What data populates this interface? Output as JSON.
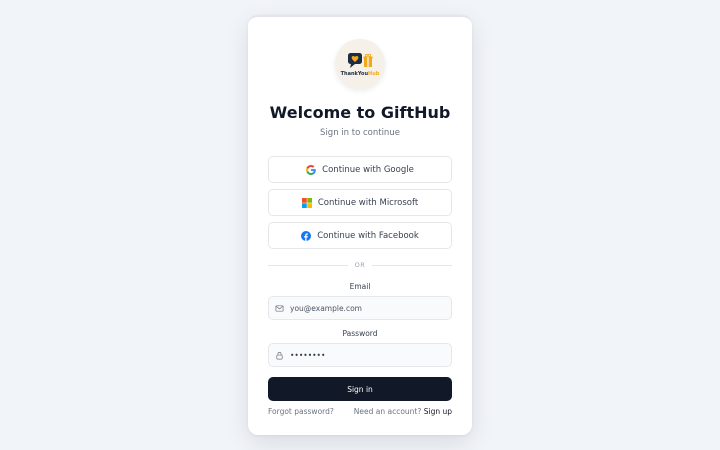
{
  "brand": {
    "logo_text_main": "ThankYou",
    "logo_text_accent": "Hub",
    "colors": {
      "navy": "#1f2a44",
      "gold": "#f2a81d"
    }
  },
  "header": {
    "title": "Welcome to GiftHub",
    "subtitle": "Sign in to continue"
  },
  "sso": {
    "google_label": "Continue with Google",
    "microsoft_label": "Continue with Microsoft",
    "facebook_label": "Continue with Facebook"
  },
  "divider_text": "OR",
  "form": {
    "email_label": "Email",
    "email_placeholder": "you@example.com",
    "password_label": "Password",
    "password_value": "password",
    "signin_label": "Sign in"
  },
  "footer": {
    "forgot_label": "Forgot password?",
    "need_account_text": "Need an account?",
    "signup_label": "Sign up"
  },
  "icons": [
    "logo-icon",
    "google-icon",
    "microsoft-icon",
    "facebook-icon",
    "mail-icon",
    "lock-icon"
  ],
  "theme": {
    "primary_button": "#111827",
    "background": "#f1f4f8",
    "card": "#ffffff"
  }
}
